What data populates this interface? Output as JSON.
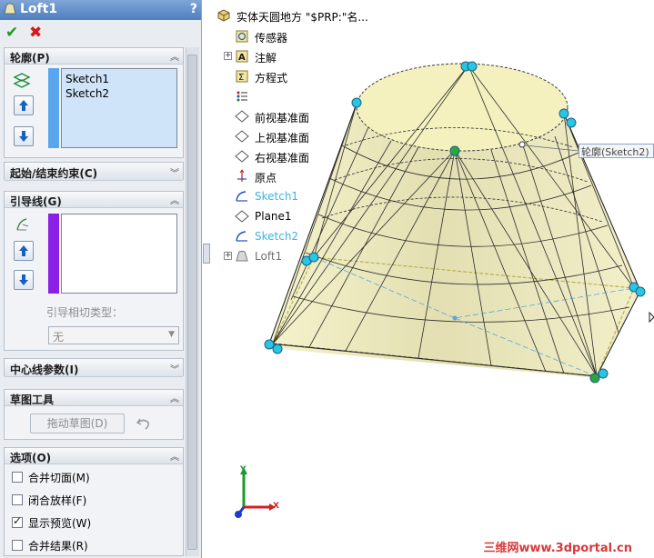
{
  "feature": {
    "title": "Loft1",
    "help": "?",
    "ok_label": "✔",
    "cancel_label": "✖"
  },
  "sections": {
    "profiles": {
      "header": "轮廓(P)",
      "items": [
        "Sketch1",
        "Sketch2"
      ]
    },
    "start_end": {
      "header": "起始/结束约束(C)"
    },
    "guides": {
      "header": "引导线(G)",
      "tangency_label": "引导相切类型：",
      "tangency_value": "无"
    },
    "centerline": {
      "header": "中心线参数(I)"
    },
    "sketch_tools": {
      "header": "草图工具",
      "drag_label": "拖动草图(D)"
    },
    "options": {
      "header": "选项(O)",
      "items": [
        {
          "label": "合并切面(M)",
          "checked": false
        },
        {
          "label": "闭合放样(F)",
          "checked": false
        },
        {
          "label": "显示预览(W)",
          "checked": true
        },
        {
          "label": "合并结果(R)",
          "checked": false
        }
      ]
    }
  },
  "tree": {
    "root": "实体天圆地方 \"$PRP:\"名...",
    "items": [
      {
        "label": "传感器",
        "icon": "sensor-icon"
      },
      {
        "label": "注解",
        "icon": "annotation-icon"
      },
      {
        "label": "方程式",
        "icon": "equation-icon"
      },
      {
        "label": "",
        "icon": "material-icon"
      },
      {
        "label": "前视基准面",
        "icon": "plane-icon"
      },
      {
        "label": "上视基准面",
        "icon": "plane-icon"
      },
      {
        "label": "右视基准面",
        "icon": "plane-icon"
      },
      {
        "label": "原点",
        "icon": "origin-icon"
      },
      {
        "label": "Sketch1",
        "icon": "sketch-icon"
      },
      {
        "label": "Plane1",
        "icon": "plane-icon"
      },
      {
        "label": "Sketch2",
        "icon": "sketch-icon"
      },
      {
        "label": "Loft1",
        "icon": "loft-icon"
      }
    ]
  },
  "viewport": {
    "profile_tag": "轮廓(Sketch2)",
    "triad_x": "X",
    "triad_y": "Y",
    "watermark": "三维网www.3dportal.cn"
  },
  "colors": {
    "profile_bar": "#5aa6ee",
    "guide_bar": "#8a1fe6",
    "model_fill": "#f2efc0",
    "sketch_blue": "#3bb5e6"
  }
}
